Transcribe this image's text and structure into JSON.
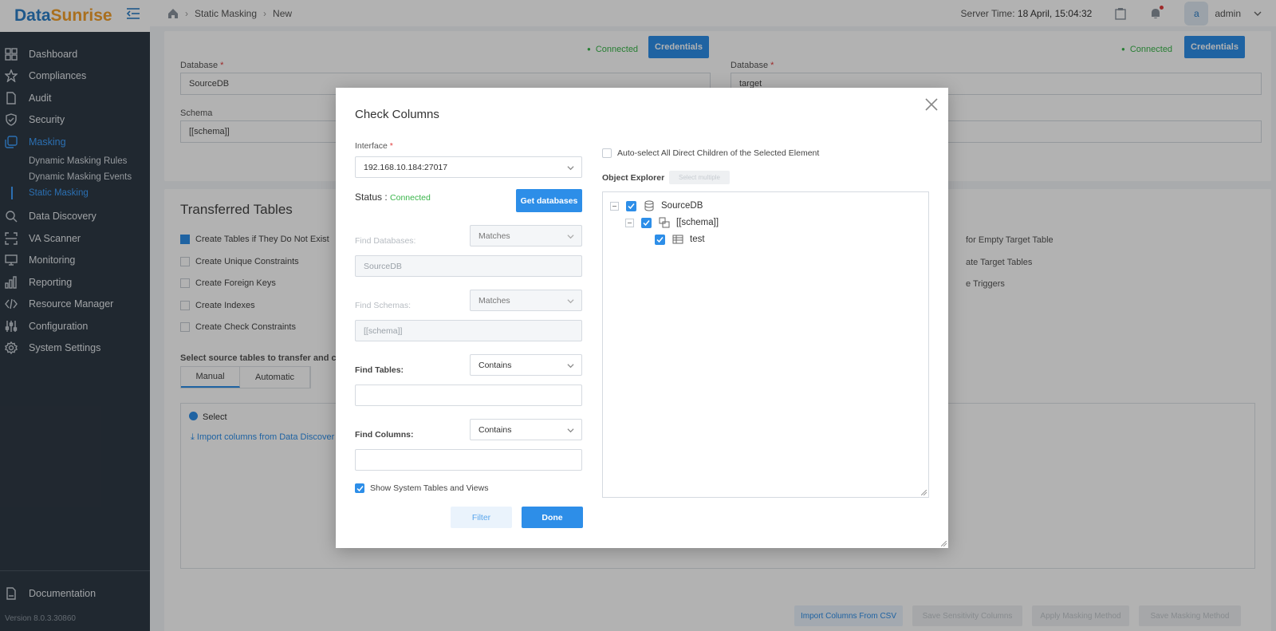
{
  "app": {
    "logo_part1": "Data",
    "logo_part2": "Sunrise",
    "version": "Version 8.0.3.30860"
  },
  "sidebar": {
    "items": [
      {
        "label": "Dashboard",
        "icon": "dashboard-icon"
      },
      {
        "label": "Compliances",
        "icon": "star-icon"
      },
      {
        "label": "Audit",
        "icon": "document-icon"
      },
      {
        "label": "Security",
        "icon": "shield-icon"
      },
      {
        "label": "Masking",
        "icon": "masking-icon"
      },
      {
        "label": "Data Discovery",
        "icon": "search-icon"
      },
      {
        "label": "VA Scanner",
        "icon": "scanner-icon"
      },
      {
        "label": "Monitoring",
        "icon": "monitor-icon"
      },
      {
        "label": "Reporting",
        "icon": "bar-chart-icon"
      },
      {
        "label": "Resource Manager",
        "icon": "code-icon"
      },
      {
        "label": "Configuration",
        "icon": "sliders-icon"
      },
      {
        "label": "System Settings",
        "icon": "gear-icon"
      }
    ],
    "subitems": [
      {
        "label": "Dynamic Masking Rules"
      },
      {
        "label": "Dynamic Masking Events"
      },
      {
        "label": "Static Masking"
      }
    ],
    "documentation": "Documentation"
  },
  "topbar": {
    "breadcrumb": [
      "Static Masking",
      "New"
    ],
    "server_time_label": "Server Time:",
    "server_time_value": "18 April, 15:04:32",
    "avatar_letter": "a",
    "username": "admin"
  },
  "background": {
    "connected": "Connected",
    "credentials": "Credentials",
    "database_label": "Database",
    "schema_label": "Schema",
    "source_db": "SourceDB",
    "source_schema": "[[schema]]",
    "target_db": "target",
    "transferred_title": "Transferred Tables",
    "checks_left": [
      {
        "label": "Create Tables if They Do Not Exist",
        "checked": true
      },
      {
        "label": "Create Unique Constraints",
        "checked": false
      },
      {
        "label": "Create Foreign Keys",
        "checked": false
      },
      {
        "label": "Create Indexes",
        "checked": false
      },
      {
        "label": "Create Check Constraints",
        "checked": false
      }
    ],
    "checks_right": [
      {
        "label": "for Empty Target Table"
      },
      {
        "label": "ate Target Tables"
      },
      {
        "label": "e Triggers"
      }
    ],
    "select_source_text": "Select source tables to transfer and colum",
    "tabs": [
      "Manual",
      "Automatic"
    ],
    "select_link": "Select",
    "import_link": "Import columns from Data Discover",
    "bottom_buttons": [
      "Import Columns From CSV",
      "Save Sensitivity Columns",
      "Apply Masking Method",
      "Save Masking Method"
    ]
  },
  "modal": {
    "title": "Check Columns",
    "interface_label": "Interface",
    "interface_value": "192.168.10.184:27017",
    "status_label": "Status :",
    "status_value": "Connected",
    "get_databases": "Get databases",
    "find_databases_label": "Find Databases:",
    "find_databases_mode": "Matches",
    "find_databases_value": "SourceDB",
    "find_schemas_label": "Find Schemas:",
    "find_schemas_mode": "Matches",
    "find_schemas_value": "[[schema]]",
    "find_tables_label": "Find Tables:",
    "find_tables_mode": "Contains",
    "find_columns_label": "Find Columns:",
    "find_columns_mode": "Contains",
    "show_system_label": "Show System Tables and Views",
    "filter_button": "Filter",
    "done_button": "Done",
    "auto_select_label": "Auto-select All Direct Children of the Selected Element",
    "object_explorer_label": "Object Explorer",
    "select_multiple": "Select multiple",
    "tree": {
      "database": "SourceDB",
      "schema": "[[schema]]",
      "table": "test"
    }
  }
}
